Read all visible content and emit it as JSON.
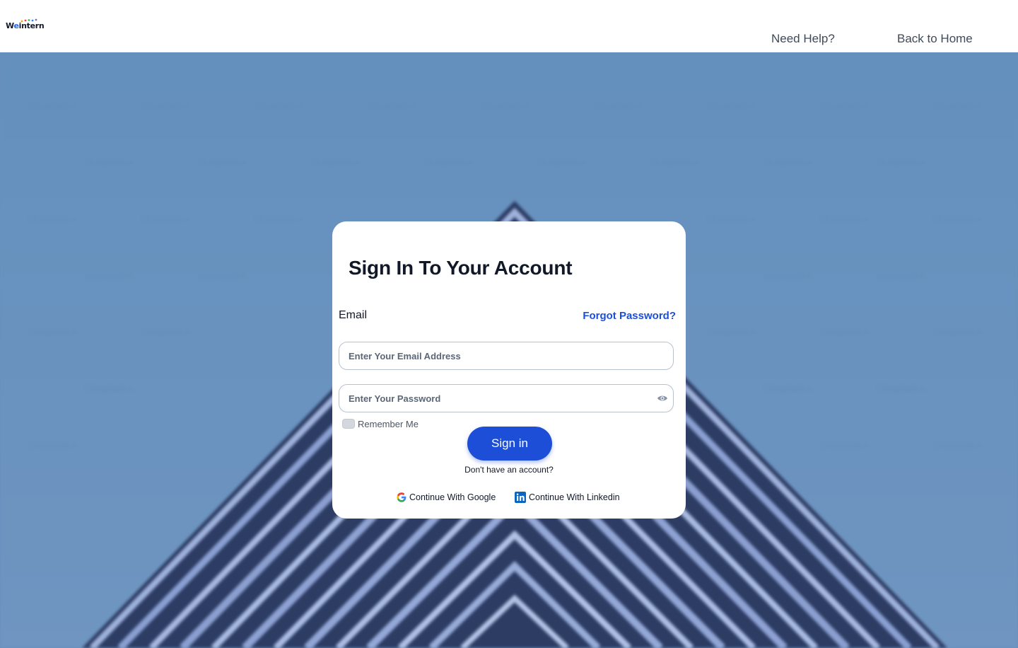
{
  "header": {
    "logo_text_prefix": "W",
    "logo_text_accent": "e",
    "logo_text_suffix": "intern",
    "nav": {
      "help": "Need Help?",
      "home": "Back to Home"
    }
  },
  "card": {
    "title": "Sign In To Your Account",
    "email_label": "Email",
    "forgot_password": "Forgot Password?",
    "email_placeholder": "Enter Your Email Address",
    "password_placeholder": "Enter Your Password",
    "remember_me": "Remember Me",
    "sign_in": "Sign in",
    "no_account": "Don't have an account?",
    "google": "Continue With Google",
    "linkedin": "Continue With Linkedin"
  },
  "icons": {
    "eye": "eye-icon",
    "google": "google-icon",
    "linkedin": "linkedin-icon"
  },
  "colors": {
    "primary": "#1d4ed8",
    "background": "#6790bd",
    "text": "#111827"
  }
}
